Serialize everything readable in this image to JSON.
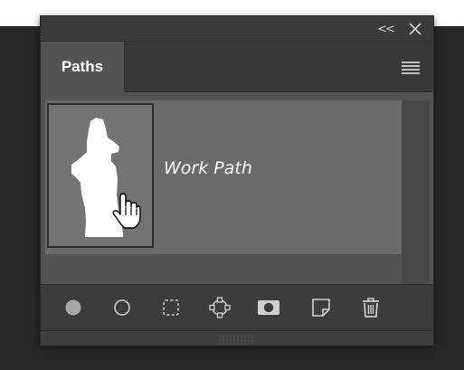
{
  "panel": {
    "title_buttons": {
      "collapse_label": "<<",
      "close_icon": "close-icon"
    },
    "tab": {
      "label": "Paths"
    },
    "menu_icon": "hamburger-menu-icon"
  },
  "paths": [
    {
      "name": "Work Path",
      "thumbnail": "figure-silhouette",
      "cursor": "hand-pointer-icon"
    }
  ],
  "footer_tools": [
    {
      "name": "fill-path-icon"
    },
    {
      "name": "stroke-path-icon"
    },
    {
      "name": "load-path-as-selection-icon"
    },
    {
      "name": "make-work-path-icon"
    },
    {
      "name": "add-mask-icon"
    },
    {
      "name": "create-new-path-icon"
    },
    {
      "name": "delete-path-icon"
    }
  ],
  "colors": {
    "backdrop": "#282828",
    "panel": "#3b3b3b",
    "row_selected": "#6b6b6b",
    "icon": "#cfcfcf"
  }
}
